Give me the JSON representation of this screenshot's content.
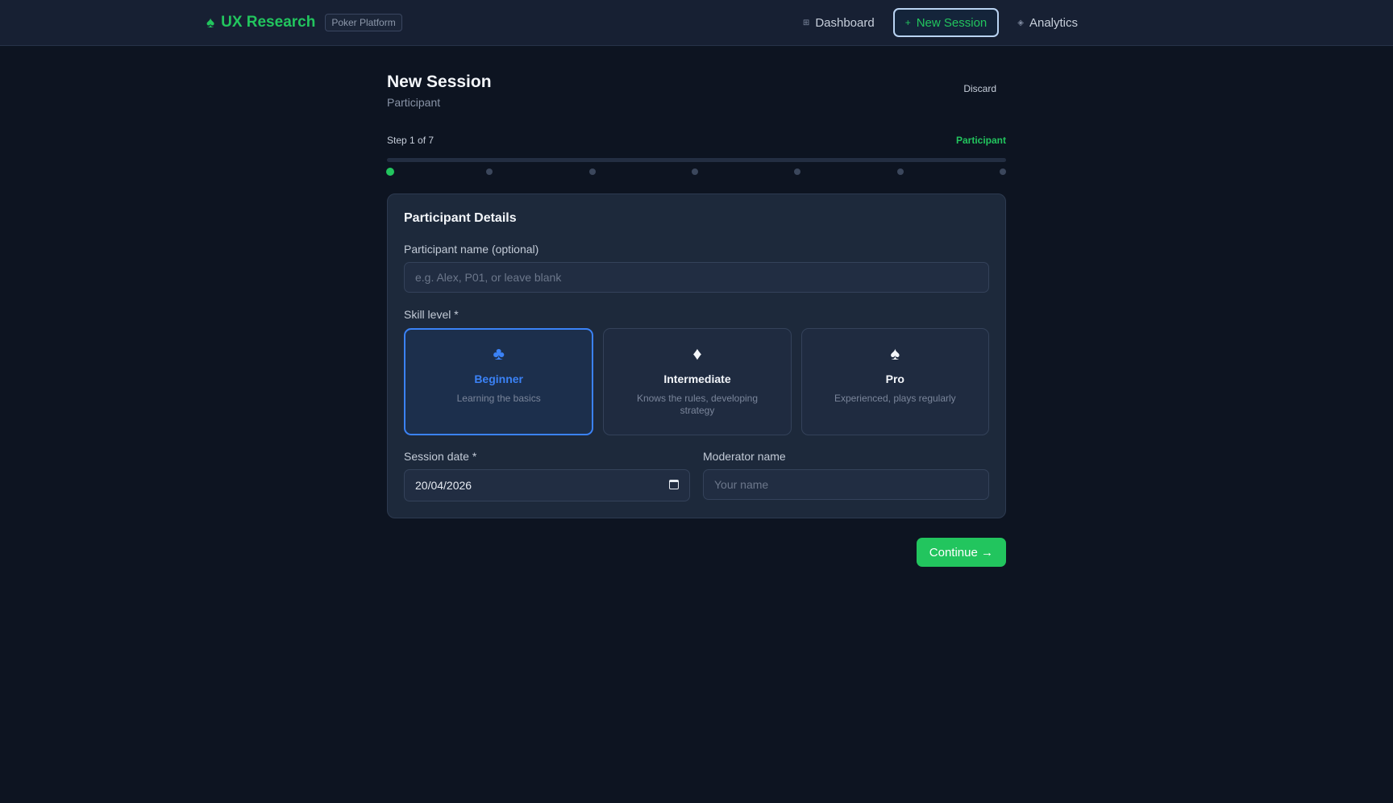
{
  "brand": {
    "icon": "spade-icon",
    "name": "UX Research",
    "badge": "Poker Platform"
  },
  "nav": [
    {
      "label": "Dashboard",
      "icon": "grid-icon",
      "glyph": "⊞",
      "active": false
    },
    {
      "label": "New Session",
      "icon": "plus-icon",
      "glyph": "+",
      "active": true
    },
    {
      "label": "Analytics",
      "icon": "diamond-icon",
      "glyph": "◈",
      "active": false
    }
  ],
  "page": {
    "title": "New Session",
    "subtitle": "Participant",
    "discard_label": "Discard"
  },
  "progress": {
    "step_text": "Step 1 of 7",
    "step_name": "Participant",
    "current": 1,
    "total": 7
  },
  "form": {
    "title": "Participant Details",
    "name_label": "Participant name (optional)",
    "name_placeholder": "e.g. Alex, P01, or leave blank",
    "name_value": "",
    "skill_label": "Skill level *",
    "skills": [
      {
        "icon": "club-icon",
        "glyph": "♣",
        "name": "Beginner",
        "desc": "Learning the basics",
        "selected": true
      },
      {
        "icon": "diamond-icon",
        "glyph": "♦",
        "name": "Intermediate",
        "desc": "Knows the rules, developing strategy",
        "selected": false
      },
      {
        "icon": "spade-icon",
        "glyph": "♠",
        "name": "Pro",
        "desc": "Experienced, plays regularly",
        "selected": false
      }
    ],
    "date_label": "Session date *",
    "date_value": "20/04/2026",
    "moderator_label": "Moderator name",
    "moderator_placeholder": "Your name",
    "moderator_value": ""
  },
  "actions": {
    "continue_label": "Continue →"
  },
  "colors": {
    "accent": "#22c55e",
    "selected": "#3b82f6",
    "background": "#0d1421",
    "surface": "#1d293b"
  }
}
